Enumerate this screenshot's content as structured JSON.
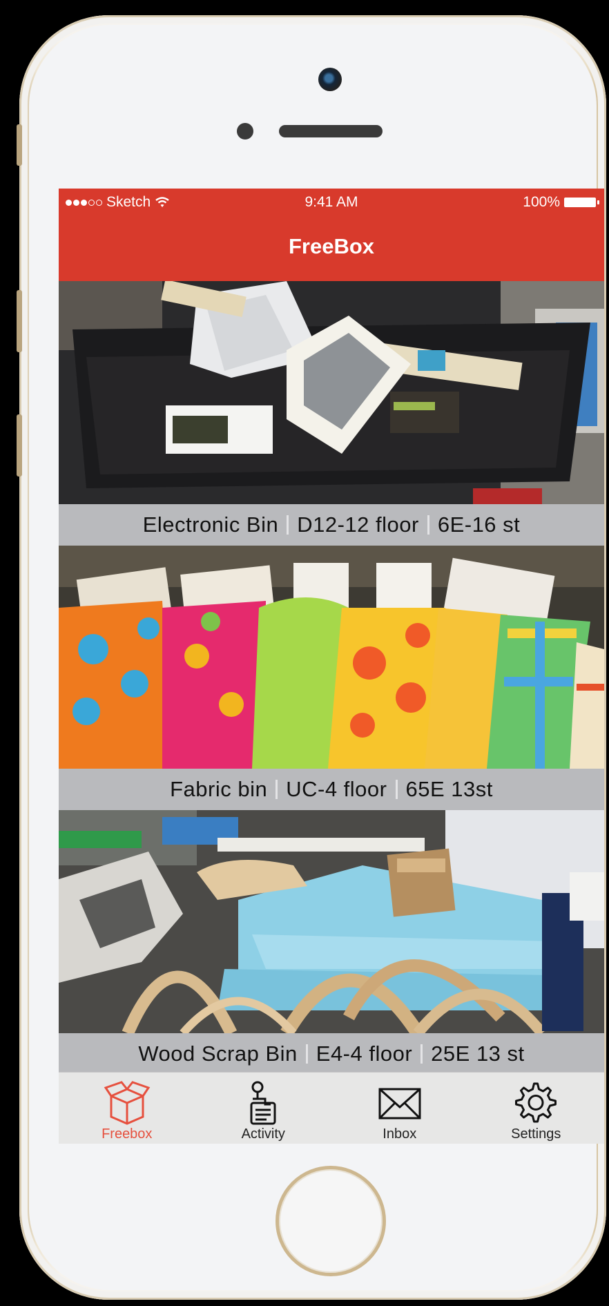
{
  "status_bar": {
    "carrier": "Sketch",
    "time": "9:41 AM",
    "battery": "100%"
  },
  "nav": {
    "title": "FreeBox"
  },
  "bins": [
    {
      "name": "Electronic Bin",
      "location": "D12-12 floor",
      "address": "6E-16 st"
    },
    {
      "name": "Fabric bin",
      "location": "UC-4 floor",
      "address": "65E 13st"
    },
    {
      "name": "Wood Scrap Bin",
      "location": "E4-4 floor",
      "address": "25E 13 st"
    }
  ],
  "tabs": [
    {
      "label": "Freebox",
      "icon": "box-icon",
      "active": true
    },
    {
      "label": "Activity",
      "icon": "activity-icon",
      "active": false
    },
    {
      "label": "Inbox",
      "icon": "envelope-icon",
      "active": false
    },
    {
      "label": "Settings",
      "icon": "gear-icon",
      "active": false
    }
  ],
  "colors": {
    "nav_red": "#d83a2c",
    "active_tab": "#e6503e",
    "caption_bg": "#b9babd"
  }
}
